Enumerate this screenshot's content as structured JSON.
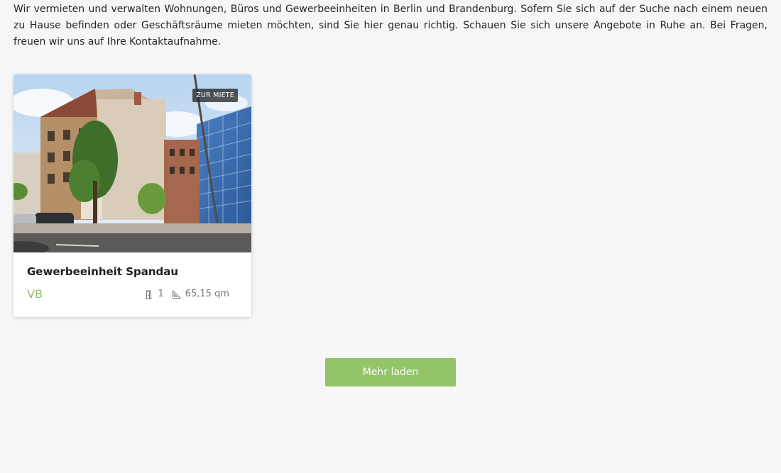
{
  "intro": {
    "text": "Wir vermieten und verwalten Wohnungen, Büros und Gewerbeeinheiten in Berlin und Brandenburg. Sofern Sie sich auf der Suche nach einem neuen zu Hause befinden oder Geschäftsräume mieten möchten, sind Sie hier genau richtig. Schauen Sie sich unsere Angebote in Ruhe an. Bei Fragen, freuen wir uns auf Ihre Kontaktaufnahme."
  },
  "listing": {
    "badge": "ZUR MIETE",
    "title": "Gewerbeeinheit Spandau",
    "price": "VB",
    "rooms": "1",
    "area": "65,15 qm",
    "icons": {
      "rooms": "door-icon",
      "area": "ruler-triangle-icon"
    }
  },
  "load_more": {
    "label": "Mehr laden"
  },
  "colors": {
    "background": "#f6f6f6",
    "accent_green": "#93c467",
    "price_green": "#8dc26a",
    "badge_bg": "#282828"
  }
}
